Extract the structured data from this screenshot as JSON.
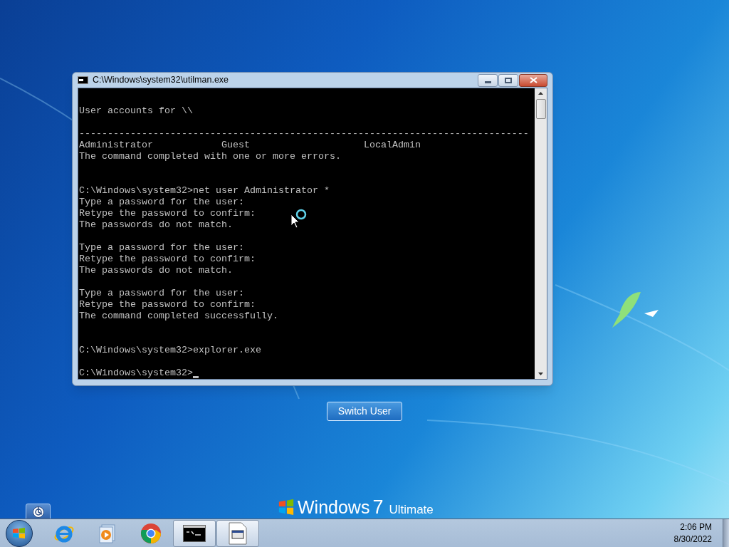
{
  "console_window": {
    "title": "C:\\Windows\\system32\\utilman.exe",
    "lines": [
      {
        "kind": "text",
        "text": "User accounts for \\\\"
      },
      {
        "kind": "blank"
      },
      {
        "kind": "text",
        "text": "-------------------------------------------------------------------------------"
      },
      {
        "kind": "text",
        "text": "Administrator            Guest                    LocalAdmin"
      },
      {
        "kind": "text",
        "text": "The command completed with one or more errors."
      },
      {
        "kind": "blank"
      },
      {
        "kind": "blank"
      },
      {
        "kind": "text",
        "text": "C:\\Windows\\system32>net user Administrator *"
      },
      {
        "kind": "text",
        "text": "Type a password for the user:"
      },
      {
        "kind": "text",
        "text": "Retype the password to confirm:"
      },
      {
        "kind": "text",
        "text": "The passwords do not match."
      },
      {
        "kind": "blank"
      },
      {
        "kind": "text",
        "text": "Type a password for the user:"
      },
      {
        "kind": "text",
        "text": "Retype the password to confirm:"
      },
      {
        "kind": "text",
        "text": "The passwords do not match."
      },
      {
        "kind": "blank"
      },
      {
        "kind": "text",
        "text": "Type a password for the user:"
      },
      {
        "kind": "text",
        "text": "Retype the password to confirm:"
      },
      {
        "kind": "text",
        "text": "The command completed successfully."
      },
      {
        "kind": "blank"
      },
      {
        "kind": "blank"
      },
      {
        "kind": "text",
        "text": "C:\\Windows\\system32>explorer.exe"
      },
      {
        "kind": "blank"
      },
      {
        "kind": "prompt",
        "text": "C:\\Windows\\system32>"
      }
    ]
  },
  "switch_user_button": {
    "label": "Switch User"
  },
  "branding": {
    "name": "Windows",
    "version": "7",
    "edition": "Ultimate"
  },
  "taskbar": {
    "items": [
      {
        "kind": "ie",
        "active": false
      },
      {
        "kind": "media",
        "active": false
      },
      {
        "kind": "chrome",
        "active": false
      },
      {
        "kind": "cmd",
        "active": true
      },
      {
        "kind": "app",
        "active": true
      }
    ],
    "clock": {
      "time": "2:06 PM",
      "date": "8/30/2022"
    }
  }
}
